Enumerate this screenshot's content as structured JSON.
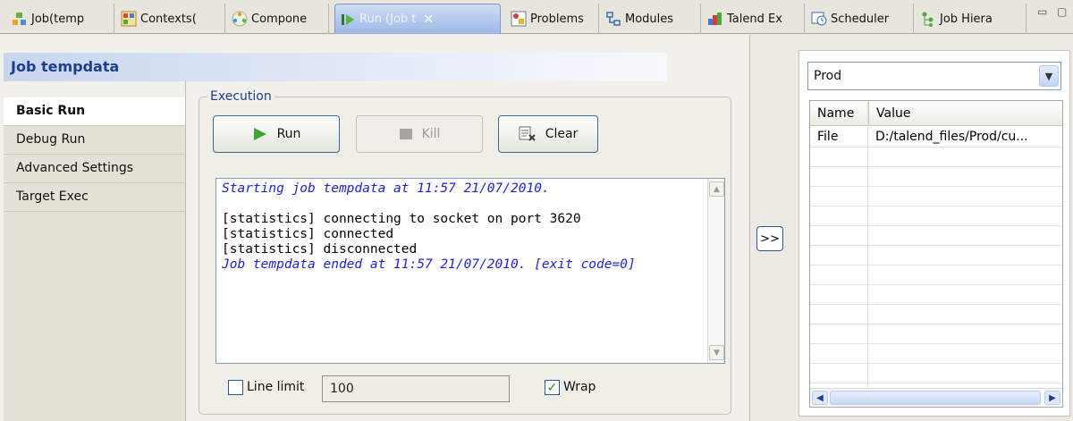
{
  "tabs": [
    {
      "label": "Job(temp",
      "icon": "job-icon"
    },
    {
      "label": "Contexts(",
      "icon": "contexts-icon"
    },
    {
      "label": "Compone",
      "icon": "component-icon"
    },
    {
      "label": "Run (Job t",
      "icon": "run-icon",
      "active": true
    },
    {
      "label": "Problems",
      "icon": "problems-icon"
    },
    {
      "label": "Modules",
      "icon": "modules-icon"
    },
    {
      "label": "Talend Ex",
      "icon": "talend-exchange-icon"
    },
    {
      "label": "Scheduler",
      "icon": "scheduler-icon"
    },
    {
      "label": "Job Hiera",
      "icon": "hierarchy-icon"
    }
  ],
  "view_title": "Job tempdata",
  "nav": [
    "Basic Run",
    "Debug Run",
    "Advanced Settings",
    "Target Exec"
  ],
  "execution": {
    "legend": "Execution",
    "run_label": "Run",
    "kill_label": "Kill",
    "clear_label": "Clear"
  },
  "console": {
    "lines": [
      {
        "text": "Starting job tempdata at 11:57 21/07/2010.",
        "style": "blue"
      },
      {
        "text": "",
        "style": "normal"
      },
      {
        "text": "[statistics] connecting to socket on port 3620",
        "style": "normal"
      },
      {
        "text": "[statistics] connected",
        "style": "normal"
      },
      {
        "text": "[statistics] disconnected",
        "style": "normal"
      },
      {
        "text": "Job tempdata ended at 11:57 21/07/2010. [exit code=0]",
        "style": "blue"
      }
    ]
  },
  "options": {
    "line_limit_label": "Line limit",
    "line_limit_checked": false,
    "line_limit_value": "100",
    "wrap_label": "Wrap",
    "wrap_checked": true
  },
  "transfer_button": ">>",
  "context": {
    "selected": "Prod",
    "columns": [
      "Name",
      "Value"
    ],
    "rows": [
      {
        "name": "File",
        "value": "D:/talend_files/Prod/cu..."
      }
    ]
  },
  "colors": {
    "title_text": "#1e3f91",
    "console_blue": "#1e22d6",
    "active_tab": "#9db8e6"
  }
}
